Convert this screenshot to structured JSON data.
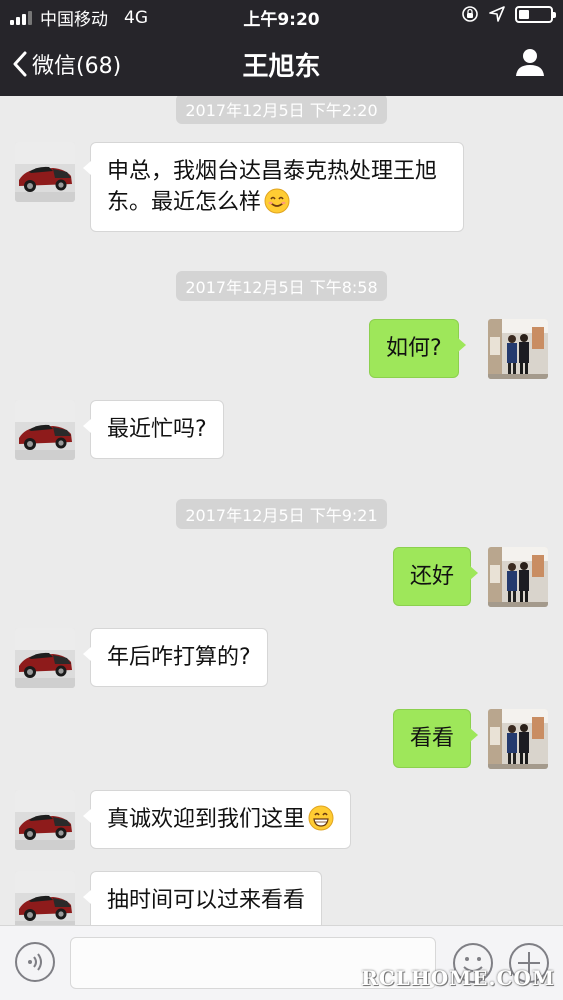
{
  "status_bar": {
    "carrier": "中国移动",
    "network": "4G",
    "time": "上午9:20"
  },
  "nav": {
    "back_label": "微信(68)",
    "title": "王旭东",
    "profile_icon": "person-icon"
  },
  "messages": [
    {
      "type": "timestamp",
      "text": "2017年12月5日 下午2:20"
    },
    {
      "type": "incoming",
      "text": "申总，我烟台达昌泰克热处理王旭东。最近怎么样",
      "emoji": "smile-emoji"
    },
    {
      "type": "timestamp",
      "text": "2017年12月5日 下午8:58"
    },
    {
      "type": "outgoing",
      "text": "如何?"
    },
    {
      "type": "incoming",
      "text": "最近忙吗?"
    },
    {
      "type": "timestamp",
      "text": "2017年12月5日 下午9:21"
    },
    {
      "type": "outgoing",
      "text": "还好"
    },
    {
      "type": "incoming",
      "text": "年后咋打算的?"
    },
    {
      "type": "outgoing",
      "text": "看看"
    },
    {
      "type": "incoming",
      "text": "真诚欢迎到我们这里",
      "emoji": "grin-emoji"
    },
    {
      "type": "incoming",
      "text": "抽时间可以过来看看"
    }
  ],
  "input_bar": {
    "voice_icon": "voice-icon",
    "emoji_icon": "emoji-face-icon",
    "plus_icon": "plus-icon",
    "input_value": ""
  },
  "watermark": "RCLHOME.COM",
  "colors": {
    "header_bg": "#26252a",
    "chat_bg": "#ebebeb",
    "outgoing_bubble": "#9ee75a",
    "incoming_bubble": "#ffffff",
    "timestamp_bg": "#d4d4d4"
  }
}
